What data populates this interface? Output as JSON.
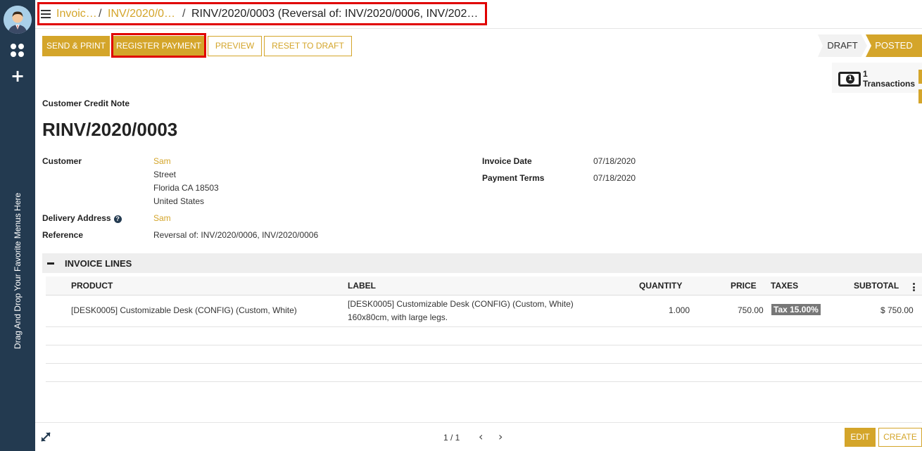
{
  "sidebar": {
    "favorites_hint": "Drag And Drop Your Favorite Menus Here"
  },
  "breadcrumb": {
    "crumb1": "Invoic…",
    "crumb2": "INV/2020/0…",
    "sep": "/",
    "current": "RINV/2020/0003 (Reversal of: INV/2020/0006, INV/202…"
  },
  "toolbar": {
    "send_print": "SEND & PRINT",
    "register_payment": "REGISTER PAYMENT",
    "preview": "PREVIEW",
    "reset_to_draft": "RESET TO DRAFT"
  },
  "status": {
    "draft": "DRAFT",
    "posted": "POSTED"
  },
  "smart_button": {
    "count": "1",
    "label": "Transactions"
  },
  "form": {
    "doc_type": "Customer Credit Note",
    "doc_name": "RINV/2020/0003",
    "customer_label": "Customer",
    "customer_name": "Sam",
    "customer_street": "Street",
    "customer_city": "Florida CA 18503",
    "customer_country": "United States",
    "delivery_label": "Delivery Address",
    "delivery_value": "Sam",
    "reference_label": "Reference",
    "reference_value": "Reversal of: INV/2020/0006, INV/2020/0006",
    "invoice_date_label": "Invoice Date",
    "invoice_date_value": "07/18/2020",
    "payment_terms_label": "Payment Terms",
    "payment_terms_value": "07/18/2020"
  },
  "lines": {
    "section_title": "INVOICE LINES",
    "columns": {
      "product": "PRODUCT",
      "label": "LABEL",
      "quantity": "QUANTITY",
      "price": "PRICE",
      "taxes": "TAXES",
      "subtotal": "SUBTOTAL"
    },
    "rows": [
      {
        "product": "[DESK0005] Customizable Desk (CONFIG) (Custom, White)",
        "label_line1": "[DESK0005] Customizable Desk (CONFIG) (Custom, White)",
        "label_line2": "160x80cm, with large legs.",
        "quantity": "1.000",
        "price": "750.00",
        "tax": "Tax 15.00%",
        "subtotal": "$ 750.00"
      }
    ]
  },
  "footer": {
    "pager": "1 / 1",
    "prev": "‹",
    "next": "›",
    "edit": "EDIT",
    "create": "CREATE"
  },
  "colors": {
    "accent": "#d4a52a",
    "sidebar": "#233a50",
    "highlight": "#e00000"
  }
}
